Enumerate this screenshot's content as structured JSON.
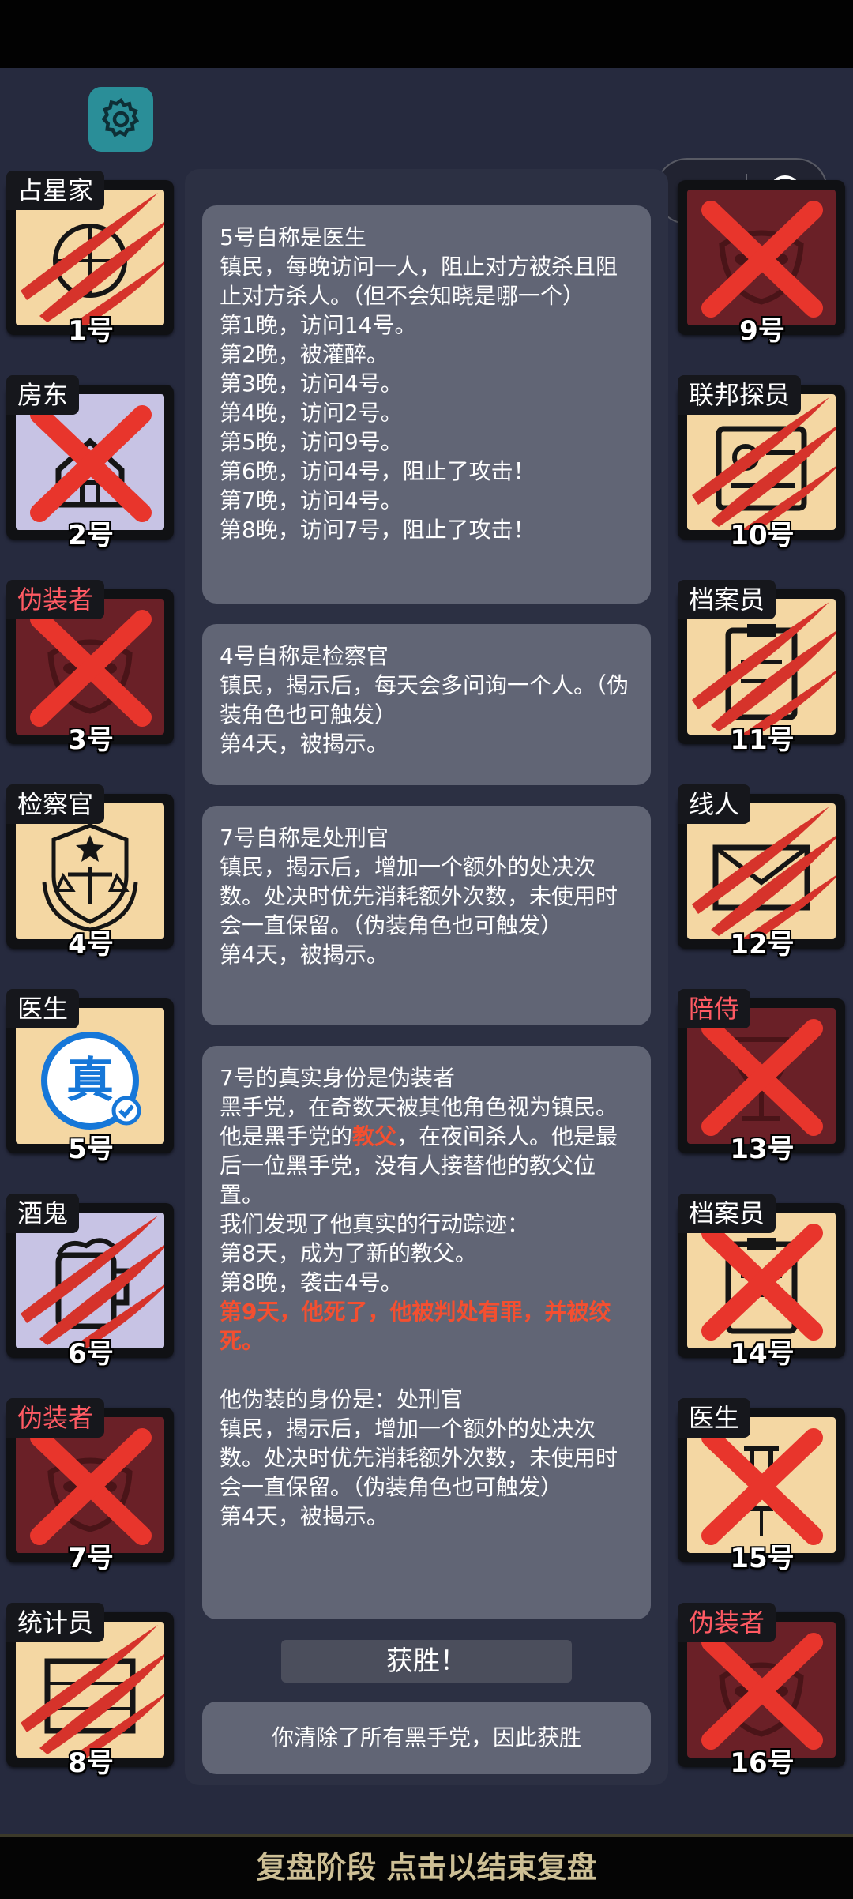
{
  "settings": {
    "icon": "gear-icon"
  },
  "capsule": {
    "more_icon": "more-icon",
    "close_icon": "target-icon"
  },
  "players_left": [
    {
      "role": "占星家",
      "num": "1号",
      "role_color": "white",
      "bg": "beige",
      "icon": "astrolabe-icon",
      "mark": "claw"
    },
    {
      "role": "房东",
      "num": "2号",
      "role_color": "white",
      "bg": "lav",
      "icon": "house-icon",
      "mark": "x"
    },
    {
      "role": "伪装者",
      "num": "3号",
      "role_color": "red",
      "bg": "maroon",
      "icon": "mask-icon",
      "mark": "x"
    },
    {
      "role": "检察官",
      "num": "4号",
      "role_color": "white",
      "bg": "beige",
      "icon": "justice-emblem-icon",
      "mark": "none"
    },
    {
      "role": "医生",
      "num": "5号",
      "role_color": "white",
      "bg": "beige",
      "icon": "verified-seal-icon",
      "mark": "none"
    },
    {
      "role": "酒鬼",
      "num": "6号",
      "role_color": "white",
      "bg": "lav",
      "icon": "mug-icon",
      "mark": "claw"
    },
    {
      "role": "伪装者",
      "num": "7号",
      "role_color": "red",
      "bg": "maroon",
      "icon": "mask-icon",
      "mark": "x"
    },
    {
      "role": "统计员",
      "num": "8号",
      "role_color": "white",
      "bg": "beige",
      "icon": "abacus-icon",
      "mark": "claw"
    }
  ],
  "players_right": [
    {
      "role": "",
      "num": "9号",
      "role_color": "red",
      "bg": "maroon",
      "icon": "mask-icon",
      "mark": "x"
    },
    {
      "role": "联邦探员",
      "num": "10号",
      "role_color": "white",
      "bg": "beige",
      "icon": "id-card-icon",
      "mark": "claw"
    },
    {
      "role": "档案员",
      "num": "11号",
      "role_color": "white",
      "bg": "beige",
      "icon": "clipboard-icon",
      "mark": "claw"
    },
    {
      "role": "线人",
      "num": "12号",
      "role_color": "white",
      "bg": "beige",
      "icon": "envelope-icon",
      "mark": "claw"
    },
    {
      "role": "陪侍",
      "num": "13号",
      "role_color": "red",
      "bg": "maroon",
      "icon": "wine-glass-icon",
      "mark": "x"
    },
    {
      "role": "档案员",
      "num": "14号",
      "role_color": "white",
      "bg": "beige",
      "icon": "clipboard-icon",
      "mark": "x"
    },
    {
      "role": "医生",
      "num": "15号",
      "role_color": "white",
      "bg": "beige",
      "icon": "syringe-icon",
      "mark": "x"
    },
    {
      "role": "伪装者",
      "num": "16号",
      "role_color": "red",
      "bg": "maroon",
      "icon": "mask-icon",
      "mark": "x"
    }
  ],
  "panels": {
    "p1": "5号自称是医生\n镇民，每晚访问一人，阻止对方被杀且阻止对方杀人。（但不会知晓是哪一个）\n第1晚，访问14号。\n第2晚，被灌醉。\n第3晚，访问4号。\n第4晚，访问2号。\n第5晚，访问9号。\n第6晚，访问4号，阻止了攻击！\n第7晚，访问4号。\n第8晚，访问7号，阻止了攻击！",
    "p2": "4号自称是检察官\n镇民，揭示后，每天会多问询一个人。（伪装角色也可触发）\n第4天，被揭示。",
    "p3": "7号自称是处刑官\n镇民，揭示后，增加一个额外的处决次数。处决时优先消耗额外次数，未使用时会一直保留。（伪装角色也可触发）\n第4天，被揭示。",
    "p4_a": "7号的真实身份是伪装者\n黑手党，在奇数天被其他角色视为镇民。\n他是黑手党的",
    "p4_hl1": "教父",
    "p4_b": "，在夜间杀人。他是最后一位黑手党，没有人接替他的教父位置。\n我们发现了他真实的行动踪迹：\n第8天，成为了新的教父。\n第8晚，袭击4号。\n",
    "p4_hl2": "第9天，他死了，他被判处有罪，并被绞死。",
    "p4_c": "\n\n他伪装的身份是：处刑官\n镇民，揭示后，增加一个额外的处决次数。处决时优先消耗额外次数，未使用时会一直保留。（伪装角色也可触发）\n第4天，被揭示。"
  },
  "victory": "获胜！",
  "final_msg": "你清除了所有黑手党，因此获胜",
  "bottom_bar": "复盘阶段 点击以结束复盘",
  "colors": {
    "highlight": "#f44f30",
    "beige": "#f4d7a3",
    "lavender": "#c7c3e4",
    "maroon": "#6a2027",
    "gear_bg": "#2a8e98"
  }
}
